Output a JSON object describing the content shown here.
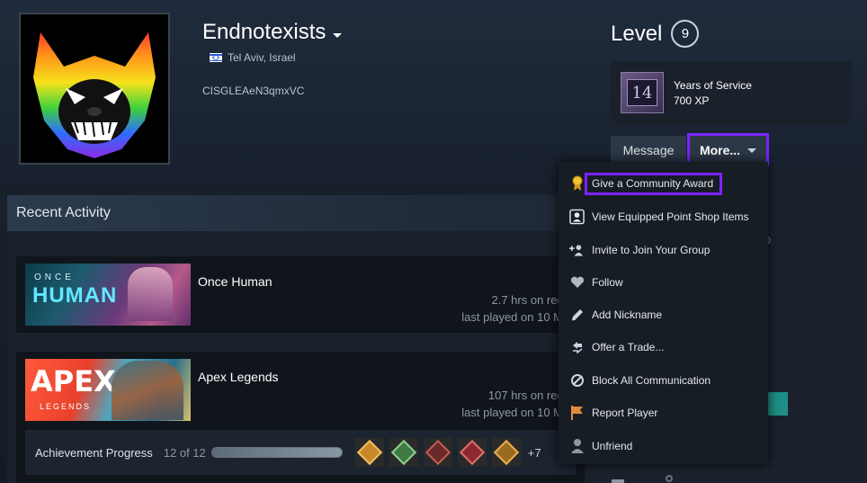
{
  "profile": {
    "username": "Endnotexists",
    "location": "Tel Aviv, Israel",
    "summary": "CISGLEAeN3qmxVC"
  },
  "level": {
    "label": "Level",
    "value": "9"
  },
  "badge": {
    "icon_text": "14",
    "title": "Years of Service",
    "xp": "700 XP"
  },
  "actions": {
    "message_label": "Message",
    "more_label": "More..."
  },
  "activity": {
    "header": "Recent Activity",
    "games": [
      {
        "name": "Once Human",
        "logo_line1": "ONCE",
        "logo_line2": "HUMAN",
        "hours": "2.7 hrs on rec",
        "last_played": "last played on 10 M"
      },
      {
        "name": "Apex Legends",
        "logo_line1": "APEX",
        "logo_line2": "LEGENDS",
        "hours": "107 hrs on rec",
        "last_played": "last played on 10 M",
        "achievements": {
          "label": "Achievement Progress",
          "count": "12 of 12",
          "progress": 1.0,
          "more": "+7"
        }
      }
    ]
  },
  "menu": {
    "items": [
      {
        "label": "Give a Community Award",
        "icon": "award-icon"
      },
      {
        "label": "View Equipped Point Shop Items",
        "icon": "profile-card-icon"
      },
      {
        "label": "Invite to Join Your Group",
        "icon": "group-invite-icon"
      },
      {
        "label": "Follow",
        "icon": "heart-icon"
      },
      {
        "label": "Add Nickname",
        "icon": "pencil-icon"
      },
      {
        "label": "Offer a Trade...",
        "icon": "trade-icon"
      },
      {
        "label": "Block All Communication",
        "icon": "block-icon"
      },
      {
        "label": "Report Player",
        "icon": "flag-icon"
      },
      {
        "label": "Unfriend",
        "icon": "user-icon"
      }
    ]
  },
  "colors": {
    "highlight": "#7b24ff",
    "accent_teal": "#1f8f86"
  }
}
